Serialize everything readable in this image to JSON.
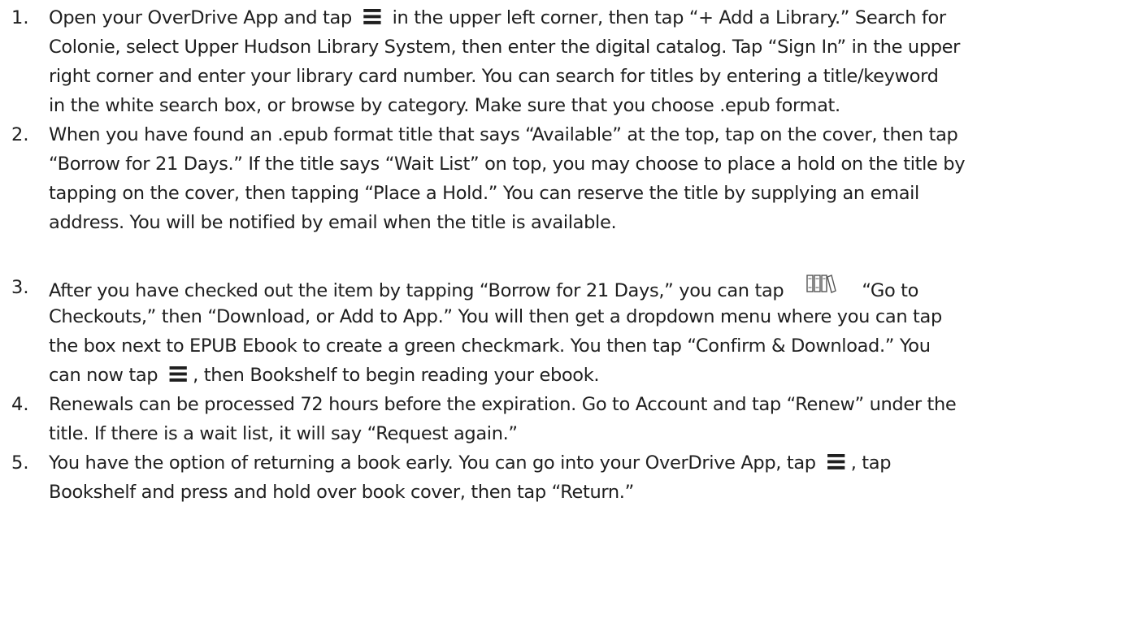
{
  "steps": [
    {
      "number": "1.",
      "lines": [
        {
          "before": "Open your OverDrive App and tap ",
          "icon": "menu-icon",
          "after": " in the upper left corner, then tap “+ Add a Library.”  Search for"
        },
        {
          "text": "Colonie, select Upper Hudson Library System, then enter the digital catalog.  Tap “Sign In” in the upper"
        },
        {
          "text": "right corner and enter your library card number.  You can search for titles by entering a title/keyword"
        },
        {
          "text": "in the white search box, or browse by category.  Make sure that you choose .epub format."
        }
      ]
    },
    {
      "number": "2.",
      "lines": [
        {
          "text": "When you have found an .epub format title that says “Available” at the top, tap on the cover, then tap"
        },
        {
          "text": "“Borrow for 21 Days.”  If the title says “Wait List” on top, you may choose to place a hold on the title by"
        },
        {
          "text": "tapping on the cover, then tapping “Place a Hold.”  You can reserve the title by supplying an email"
        },
        {
          "text": "address.  You will be notified by email when the title is available."
        }
      ]
    },
    {
      "number": "3.",
      "lines": [
        {
          "before": "After you have checked out the item by tapping “Borrow for 21 Days,” you can tap",
          "icon": "bookshelf-icon",
          "after": "“Go to"
        },
        {
          "text": "Checkouts,” then “Download, or Add to App.”  You will then get a dropdown menu where you can tap"
        },
        {
          "text": "the box next to EPUB Ebook to create a green checkmark.  You then tap “Confirm & Download.”  You"
        },
        {
          "before": "can now tap ",
          "icon": "menu-icon",
          "after": ", then Bookshelf to begin reading your ebook."
        }
      ]
    },
    {
      "number": "4.",
      "lines": [
        {
          "text": "Renewals can be processed 72 hours before the expiration.  Go to Account and tap “Renew” under the"
        },
        {
          "text": "title.  If there is a wait list, it will say “Request again.”"
        }
      ]
    },
    {
      "number": "5.",
      "lines": [
        {
          "before": "You have the option of returning a book early.  You can go into your OverDrive App, tap ",
          "icon": "menu-icon",
          "after": ", tap"
        },
        {
          "text": "Bookshelf and press and hold over book cover, then tap “Return.”"
        }
      ]
    }
  ],
  "icons": {
    "menu_glyph": "≡",
    "icon_color": "#1f1f1f",
    "bookshelf_color": "#555555"
  }
}
